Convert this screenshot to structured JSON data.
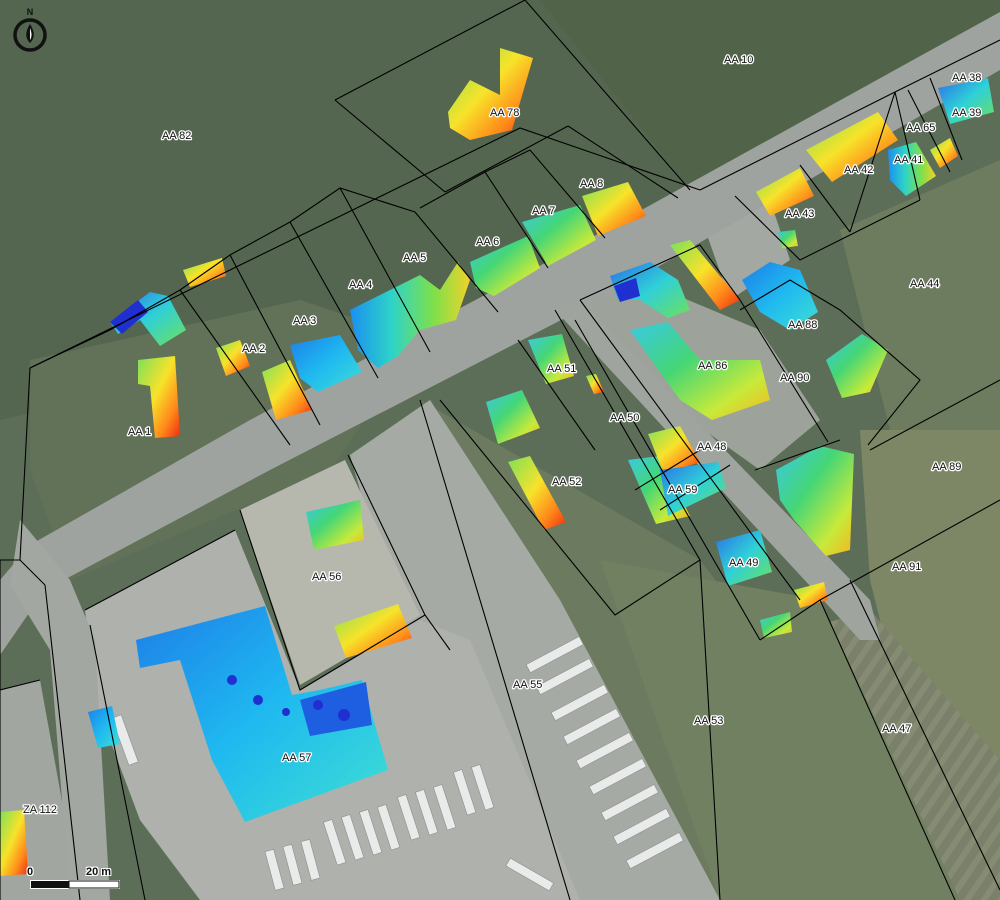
{
  "map": {
    "north_label": "N",
    "scale": {
      "zero_label": "0",
      "max_label": "20 m"
    },
    "parcels": [
      {
        "id": "AA 82"
      },
      {
        "id": "AA 10"
      },
      {
        "id": "AA 38"
      },
      {
        "id": "AA 39"
      },
      {
        "id": "AA 65"
      },
      {
        "id": "AA 78"
      },
      {
        "id": "AA 42"
      },
      {
        "id": "AA 41"
      },
      {
        "id": "AA 8"
      },
      {
        "id": "AA 7"
      },
      {
        "id": "AA 43"
      },
      {
        "id": "AA 6"
      },
      {
        "id": "AA 5"
      },
      {
        "id": "AA 44"
      },
      {
        "id": "AA 4"
      },
      {
        "id": "AA 3"
      },
      {
        "id": "AA 88"
      },
      {
        "id": "AA 2"
      },
      {
        "id": "AA 86"
      },
      {
        "id": "AA 51"
      },
      {
        "id": "AA 90"
      },
      {
        "id": "AA 1"
      },
      {
        "id": "AA 50"
      },
      {
        "id": "AA 48"
      },
      {
        "id": "AA 89"
      },
      {
        "id": "AA 52"
      },
      {
        "id": "AA 59"
      },
      {
        "id": "AA 49"
      },
      {
        "id": "AA 56"
      },
      {
        "id": "AA 91"
      },
      {
        "id": "AA 55"
      },
      {
        "id": "AA 53"
      },
      {
        "id": "AA 47"
      },
      {
        "id": "AA 57"
      },
      {
        "id": "ZA 112"
      }
    ],
    "colors": {
      "vegetation": "#55684f",
      "road": "#9aa09a",
      "parking": "#a9aca8",
      "parcel_line": "#000000",
      "heat_low": "#1f2fd0",
      "heat_mid": "#3fd17a",
      "heat_high": "#f02a12"
    }
  }
}
